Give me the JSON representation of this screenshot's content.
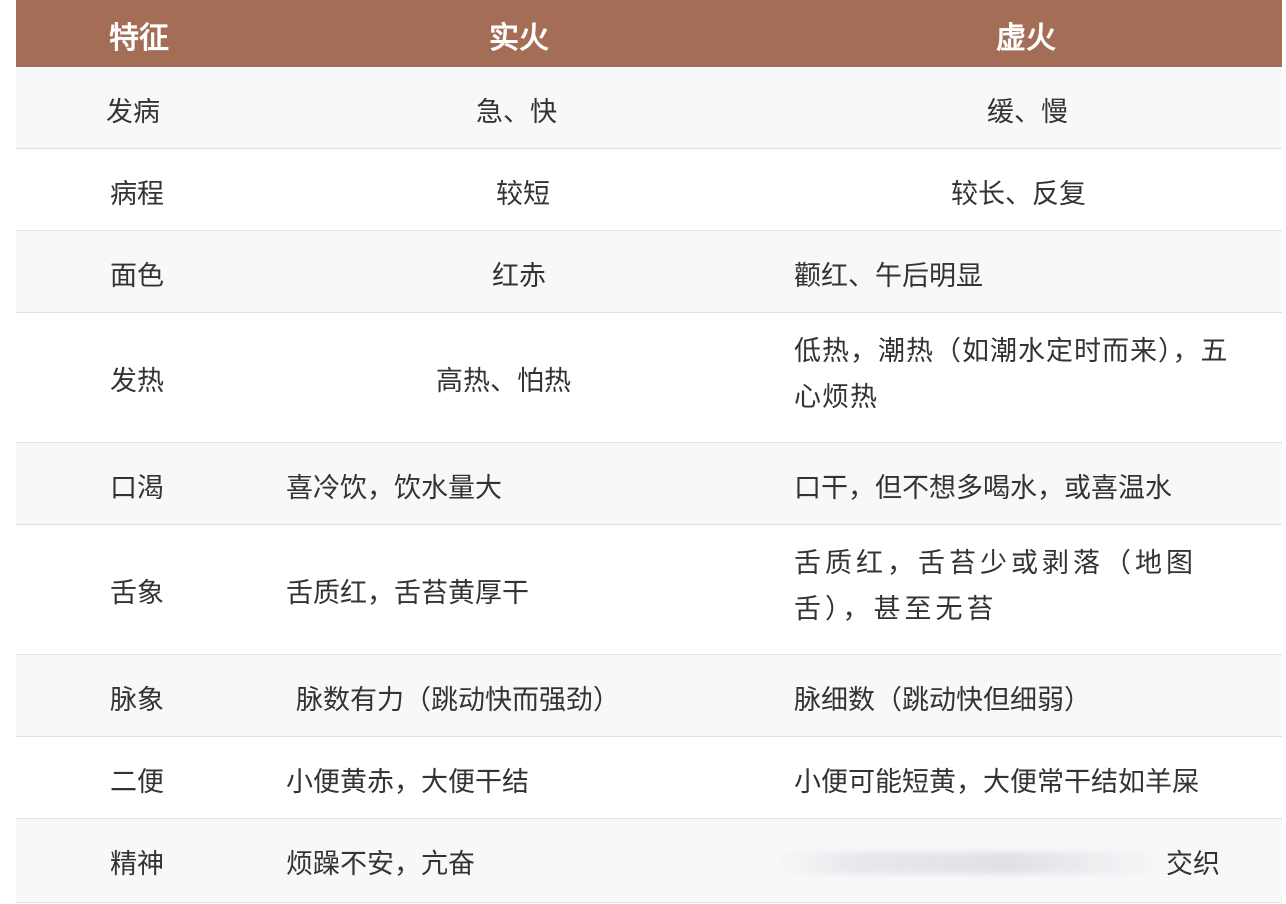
{
  "header": {
    "col1": "特征",
    "col2": "实火",
    "col3": "虚火"
  },
  "rows": [
    {
      "feature": "发病",
      "excess": "急、快",
      "deficiency": "缓、慢"
    },
    {
      "feature": "病程",
      "excess": "较短",
      "deficiency": "较长、反复"
    },
    {
      "feature": "面色",
      "excess": "红赤",
      "deficiency": "颧红、午后明显"
    },
    {
      "feature": "发热",
      "excess": "高热、怕热",
      "deficiency": "低热，潮热（如潮水定时而来），五心烦热"
    },
    {
      "feature": "口渴",
      "excess": "喜冷饮，饮水量大",
      "deficiency": "口干，但不想多喝水，或喜温水"
    },
    {
      "feature": "舌象",
      "excess": "舌质红，舌苔黄厚干",
      "deficiency": "舌质红，舌苔少或剥落（地图舌），甚至无苔"
    },
    {
      "feature": "脉象",
      "excess": "脉数有力（跳动快而强劲）",
      "deficiency": "脉细数（跳动快但细弱）"
    },
    {
      "feature": "二便",
      "excess": "小便黄赤，大便干结",
      "deficiency": "小便可能短黄，大便常干结如羊屎"
    },
    {
      "feature": "精神",
      "excess": "烦躁不安，亢奋",
      "deficiency": "交织"
    }
  ],
  "colors": {
    "header_bg": "#a46d55",
    "header_text": "#ffffff",
    "row_alt_bg": "#f8f8fa"
  }
}
